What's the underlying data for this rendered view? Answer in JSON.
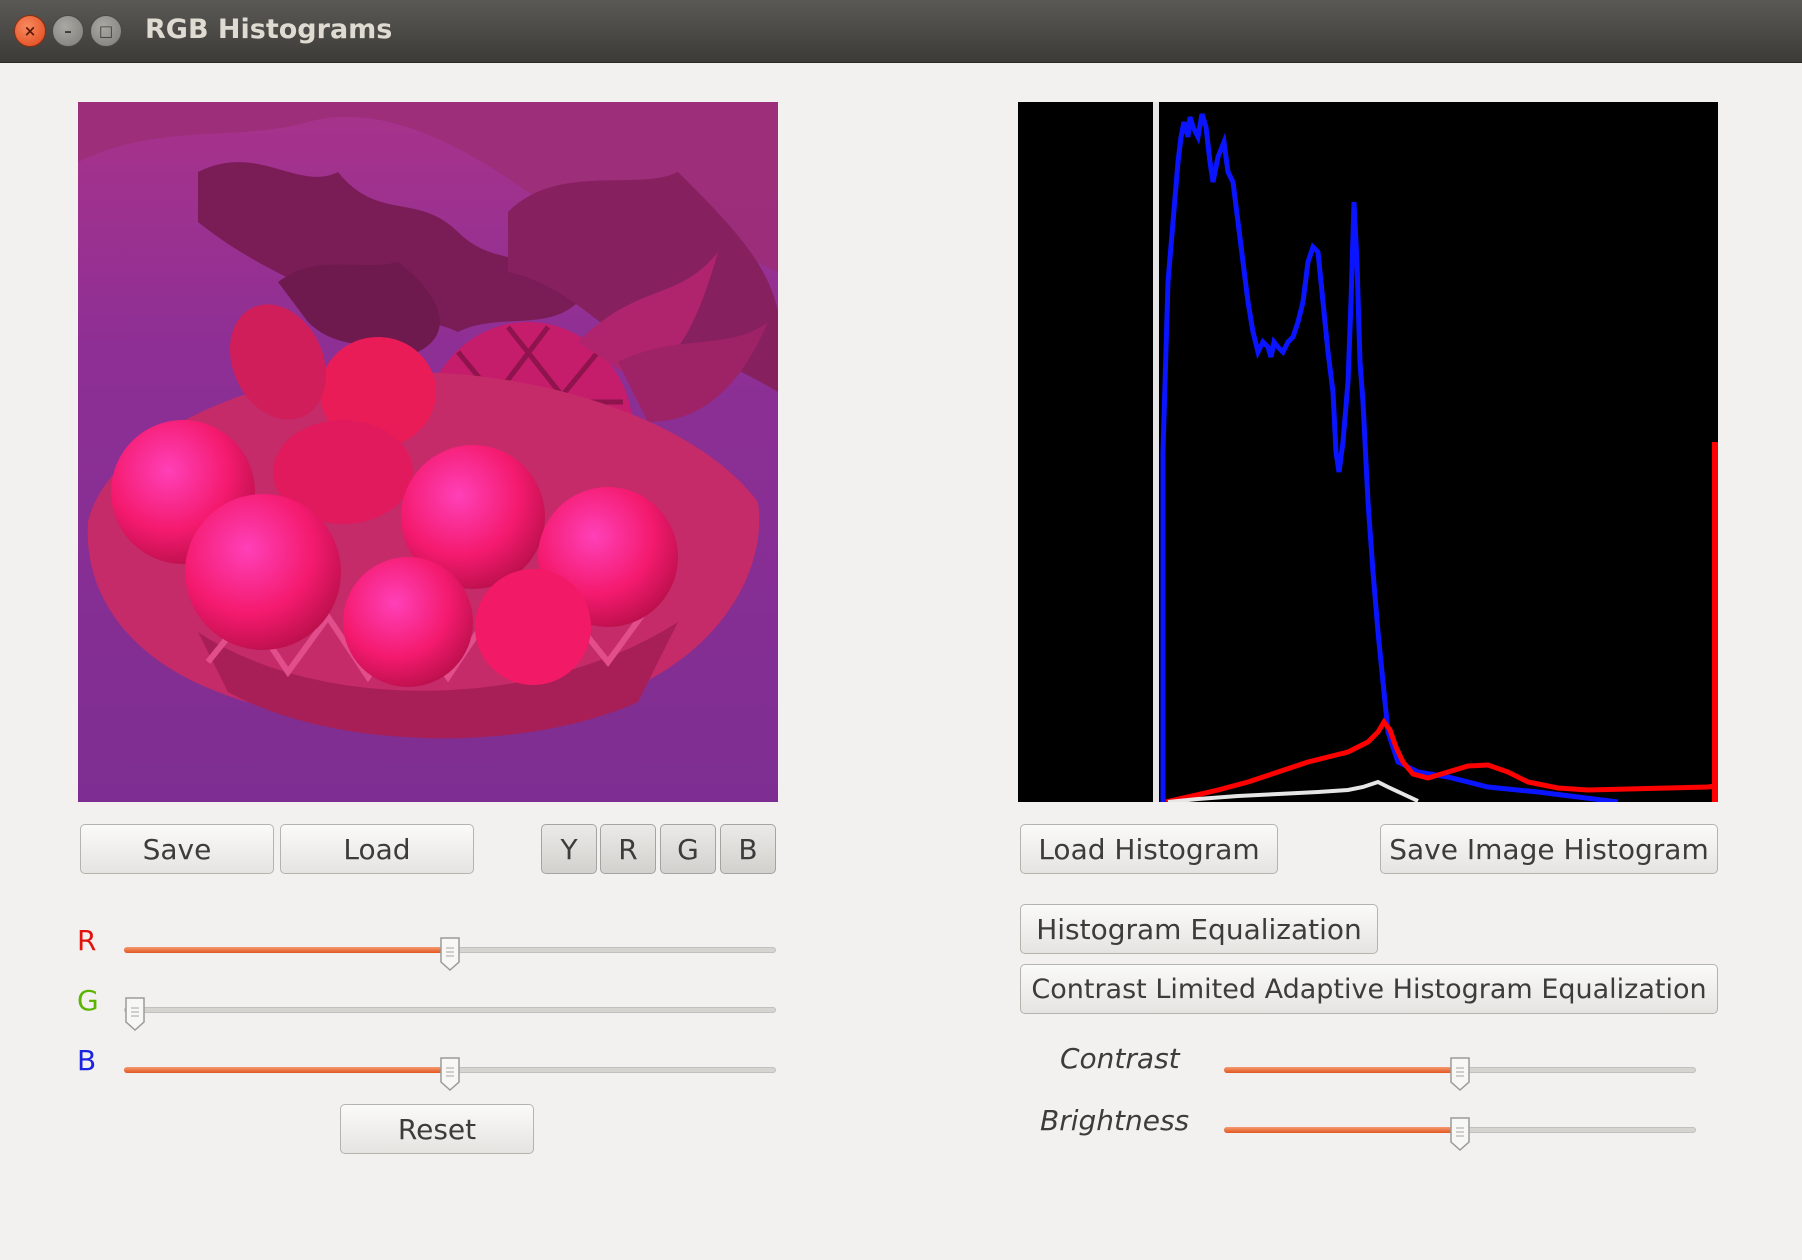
{
  "window": {
    "title": "RGB Histograms",
    "buttons": {
      "close": "×",
      "minimize": "–",
      "maximize": "□"
    }
  },
  "left_panel": {
    "save_label": "Save",
    "load_label": "Load",
    "channel_buttons": [
      "Y",
      "R",
      "G",
      "B"
    ],
    "sliders": [
      {
        "label": "R",
        "color": "#e0140c",
        "value": 0.5
      },
      {
        "label": "G",
        "color": "#5ab400",
        "value": 0.0
      },
      {
        "label": "B",
        "color": "#1a24e0",
        "value": 0.5
      }
    ],
    "reset_label": "Reset"
  },
  "right_panel": {
    "load_histogram_label": "Load Histogram",
    "save_image_histogram_label": "Save Image Histogram",
    "histogram_equalization_label": "Histogram Equalization",
    "clahe_label": "Contrast Limited Adaptive Histogram Equalization",
    "contrast_label": "Contrast",
    "brightness_label": "Brightness",
    "contrast_value": 0.5,
    "brightness_value": 0.5
  },
  "histogram_colors": {
    "blue": "#0a14ff",
    "red": "#ff0000",
    "white": "#e6e6e6"
  }
}
